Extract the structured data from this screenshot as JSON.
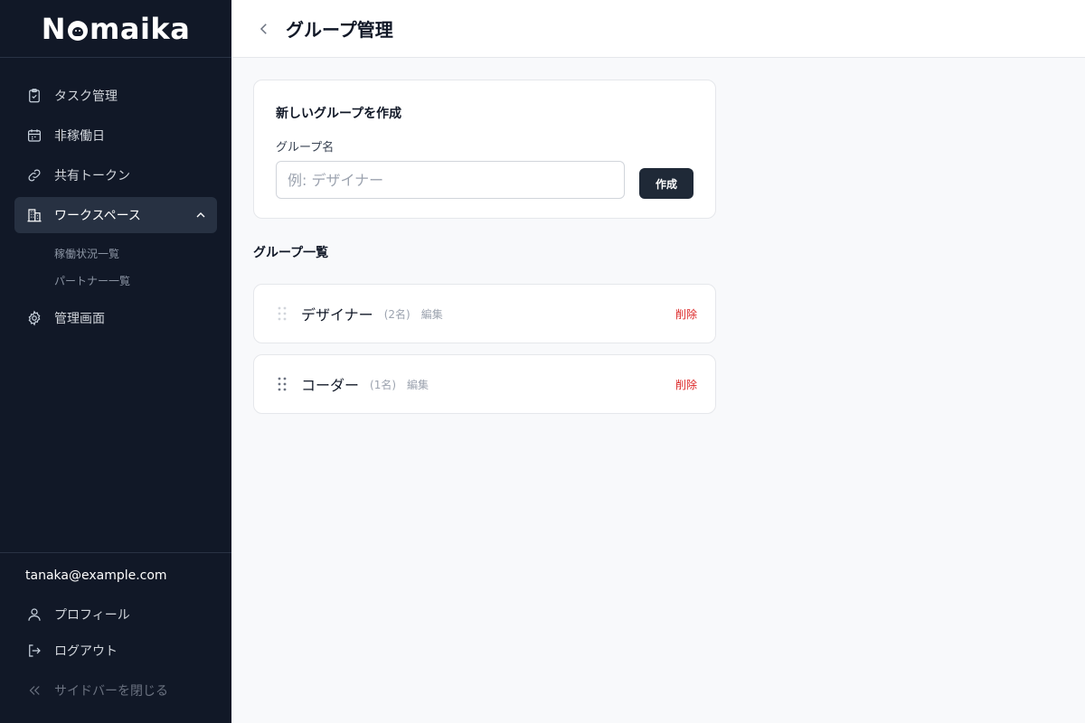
{
  "brand": {
    "logo": "Nomaika",
    "logo_prefix": "N",
    "logo_suffix": "maika"
  },
  "sidebar": {
    "items": [
      {
        "label": "タスク管理",
        "icon": "clipboard-check-icon"
      },
      {
        "label": "非稼働日",
        "icon": "calendar-icon"
      },
      {
        "label": "共有トークン",
        "icon": "link-icon"
      },
      {
        "label": "ワークスペース",
        "icon": "building-icon",
        "active": true,
        "expanded": true
      },
      {
        "label": "管理画面",
        "icon": "gear-icon"
      }
    ],
    "subitems": [
      {
        "label": "稼働状況一覧"
      },
      {
        "label": "パートナー一覧"
      }
    ],
    "user_email": "tanaka@example.com",
    "profile_label": "プロフィール",
    "logout_label": "ログアウト",
    "collapse_label": "サイドバーを閉じる"
  },
  "header": {
    "title": "グループ管理"
  },
  "create_form": {
    "title": "新しいグループを作成",
    "field_label": "グループ名",
    "placeholder": "例: デザイナー",
    "value": "",
    "submit_label": "作成"
  },
  "groups_section": {
    "title": "グループ一覧",
    "groups": [
      {
        "name": "デザイナー",
        "count": "(2名)",
        "edit_label": "編集",
        "delete_label": "削除"
      },
      {
        "name": "コーダー",
        "count": "(1名)",
        "edit_label": "編集",
        "delete_label": "削除"
      }
    ]
  },
  "colors": {
    "sidebar_bg": "#111827",
    "accent_button": "#1f2937",
    "delete": "#dc2626",
    "page_bg": "#f8f9fb"
  }
}
